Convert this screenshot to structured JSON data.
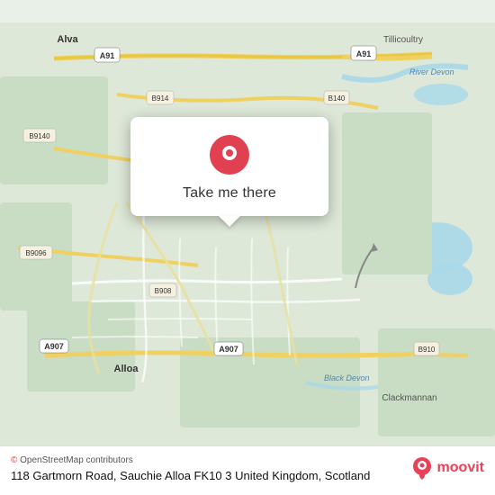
{
  "map": {
    "attribution": "© OpenStreetMap contributors",
    "background_color": "#dde8d8"
  },
  "popup": {
    "button_label": "Take me there",
    "pin_color": "#e0415a"
  },
  "bottom_bar": {
    "attribution_text": "© OpenStreetMap contributors",
    "address": "118 Gartmorn Road, Sauchie Alloa FK10 3 United Kingdom, Scotland",
    "moovit_label": "moovit"
  },
  "road_labels": {
    "a91_1": "A91",
    "a91_2": "A91",
    "b908": "B908",
    "b9140": "B9140",
    "b914": "B914",
    "b140": "B140",
    "b9096": "B9096",
    "a907_1": "A907",
    "a907_2": "A907",
    "b910": "B910",
    "tillicoultry": "Tillicoultry",
    "alva": "Alva",
    "alloa": "Alloa",
    "clackmannan": "Clackmannan",
    "river_devon": "River Devon",
    "black_devon": "Black Devon"
  }
}
